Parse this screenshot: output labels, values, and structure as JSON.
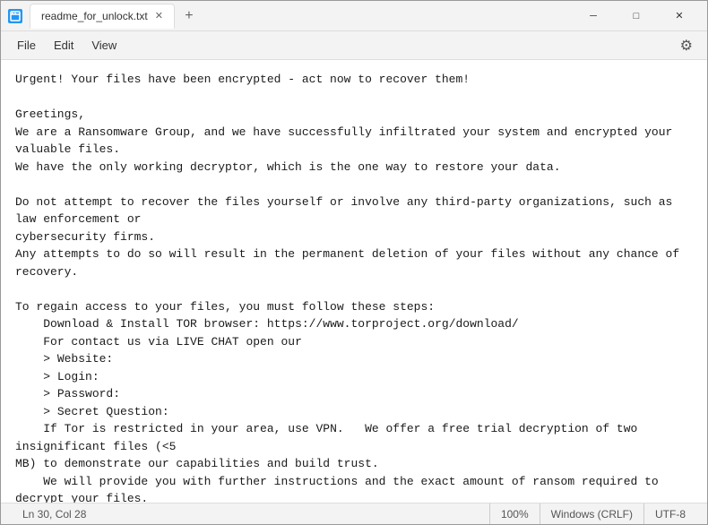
{
  "window": {
    "title": "readme_for_unlock.txt",
    "icon_color": "#2196F3"
  },
  "titlebar": {
    "tab_label": "readme_for_unlock.txt",
    "new_tab_label": "+",
    "minimize_label": "─",
    "maximize_label": "□",
    "close_label": "✕"
  },
  "menubar": {
    "file_label": "File",
    "edit_label": "Edit",
    "view_label": "View",
    "settings_icon": "⚙"
  },
  "content": {
    "text": "Urgent! Your files have been encrypted - act now to recover them!\n\nGreetings,\nWe are a Ransomware Group, and we have successfully infiltrated your system and encrypted your valuable files.\nWe have the only working decryptor, which is the one way to restore your data.\n\nDo not attempt to recover the files yourself or involve any third-party organizations, such as law enforcement or\ncybersecurity firms.\nAny attempts to do so will result in the permanent deletion of your files without any chance of recovery.\n\nTo regain access to your files, you must follow these steps:\n    Download & Install TOR browser: https://www.torproject.org/download/\n    For contact us via LIVE CHAT open our\n    > Website:\n    > Login:\n    > Password:\n    > Secret Question:\n    If Tor is restricted in your area, use VPN.   We offer a free trial decryption of two insignificant files (<5\nMB) to demonstrate our capabilities and build trust.\n    We will provide you with further instructions and the exact amount of ransom required to decrypt your files.\n    Make the payment in Bitcoin to the provided wallet address.\n    Once the payment is confirmed, we will send you the decryptor.\n\nPlease note that you have a limited time to act before the deadline expires.\nAfter that, the decryptor will be destroyed, and your files will remain encrypted forever.\nDo not ignore this message or attempt to deceive us.\nWe have already infiltrated your system, and we can easily detect any attempts to bypass our ransom demands.\n\nTake this situation seriously and act quickly to recover your files.\nWrite to us in the chat to begin the process.\n\nSincerely, Ransomware Group"
  },
  "statusbar": {
    "position": "Ln 30, Col 28",
    "zoom": "100%",
    "line_ending": "Windows (CRLF)",
    "encoding": "UTF-8"
  }
}
